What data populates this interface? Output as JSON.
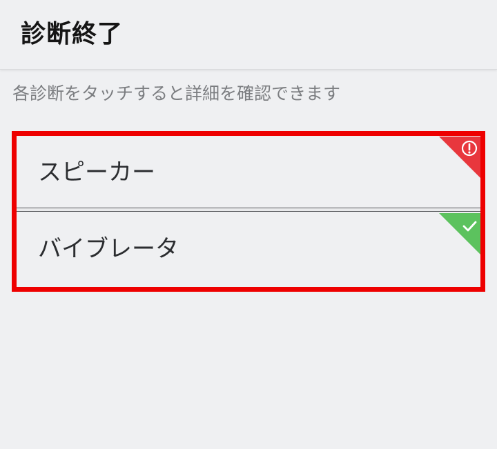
{
  "header": {
    "title": "診断終了"
  },
  "instruction": "各診断をタッチすると詳細を確認できます",
  "diagnostics": [
    {
      "label": "スピーカー",
      "status": "error",
      "status_icon": "alert-icon",
      "status_color": "#e8373d"
    },
    {
      "label": "バイブレータ",
      "status": "ok",
      "status_icon": "check-icon",
      "status_color": "#5cc25e"
    }
  ],
  "highlight_color": "#ee0000"
}
